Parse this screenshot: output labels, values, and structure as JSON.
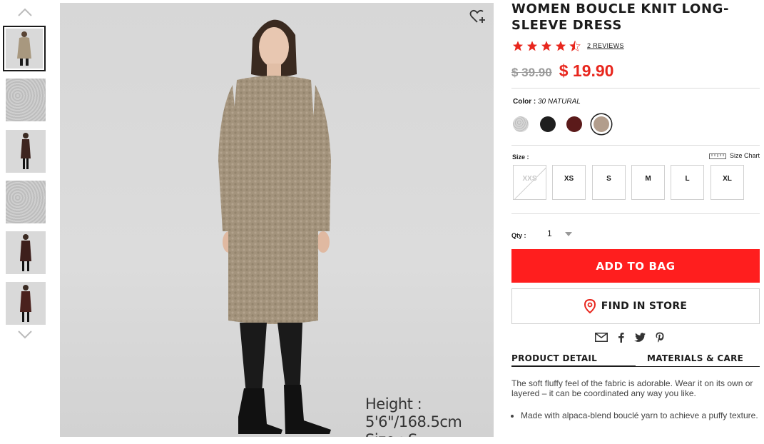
{
  "product": {
    "title": "WOMEN BOUCLE KNIT LONG-SLEEVE DRESS",
    "rating": 4.5,
    "reviews": "2 REVIEWS",
    "old_price": "$ 39.90",
    "price": "$ 19.90"
  },
  "color": {
    "label": "Color :",
    "selected": "30 NATURAL",
    "swatches": [
      {
        "name": "light gray",
        "hex": "#c9c9c9"
      },
      {
        "name": "black",
        "hex": "#1e1e1e"
      },
      {
        "name": "wine",
        "hex": "#5b1a1a"
      },
      {
        "name": "natural",
        "hex": "#b29d8c"
      }
    ]
  },
  "size": {
    "label": "Size :",
    "chart_label": "Size Chart",
    "options": [
      "XXS",
      "XS",
      "S",
      "M",
      "L",
      "XL"
    ]
  },
  "qty": {
    "label": "Qty :",
    "value": "1"
  },
  "buttons": {
    "add_to_bag": "ADD TO BAG",
    "find_in_store": "FIND IN STORE"
  },
  "tabs": [
    "PRODUCT DETAIL",
    "MATERIALS & CARE"
  ],
  "detail": {
    "description": "The soft fluffy feel of the fabric is adorable. Wear it on its own or layered – it can be coordinated any way you like.",
    "bullets": [
      "Made with alpaca-blend bouclé yarn to achieve a puffy texture."
    ]
  },
  "image_caption": {
    "height": "Height : 5'6\"/168.5cm",
    "size": "Size : S"
  },
  "colors": {
    "accent": "#ff1e1e",
    "price_red": "#e8261d",
    "text": "#1b1b1b"
  }
}
